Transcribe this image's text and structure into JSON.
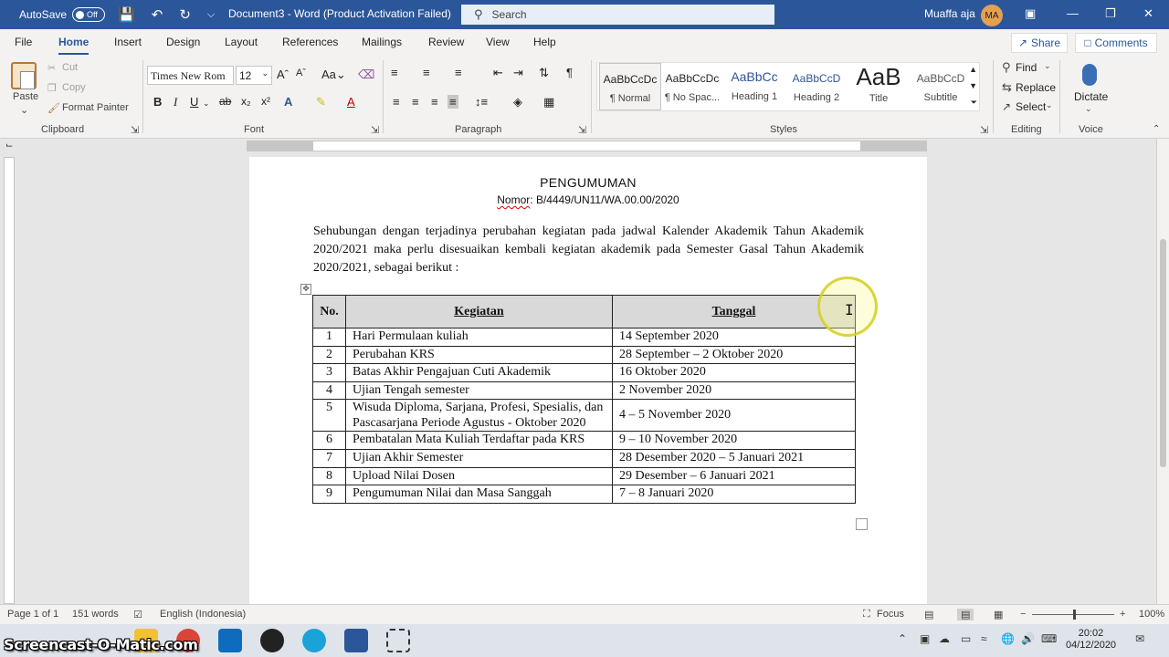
{
  "titlebar": {
    "autosave_label": "AutoSave",
    "autosave_state": "Off",
    "doc_title": "Document3 - Word (Product Activation Failed)",
    "search_placeholder": "Search",
    "user_name": "Muaffa aja",
    "user_initials": "MA"
  },
  "tabs": [
    "File",
    "Home",
    "Insert",
    "Design",
    "Layout",
    "References",
    "Mailings",
    "Review",
    "View",
    "Help"
  ],
  "tabs_active": "Home",
  "share_label": "Share",
  "comments_label": "Comments",
  "ribbon": {
    "clipboard": {
      "paste": "Paste",
      "cut": "Cut",
      "copy": "Copy",
      "format_painter": "Format Painter",
      "label": "Clipboard"
    },
    "font": {
      "name": "Times New Rom",
      "size": "12",
      "label": "Font",
      "grow": "A^",
      "shrink": "Aˇ",
      "case": "Aa"
    },
    "paragraph": {
      "label": "Paragraph"
    },
    "styles": {
      "label": "Styles",
      "items": [
        {
          "preview": "AaBbCcDc",
          "name": "¶ Normal"
        },
        {
          "preview": "AaBbCcDc",
          "name": "¶ No Spac..."
        },
        {
          "preview": "AaBbCc",
          "name": "Heading 1"
        },
        {
          "preview": "AaBbCcD",
          "name": "Heading 2"
        },
        {
          "preview": "AaB",
          "name": "Title"
        },
        {
          "preview": "AaBbCcD",
          "name": "Subtitle"
        }
      ]
    },
    "editing": {
      "find": "Find",
      "replace": "Replace",
      "select": "Select",
      "label": "Editing"
    },
    "voice": {
      "dictate": "Dictate",
      "label": "Voice"
    }
  },
  "document": {
    "heading": "PENGUMUMAN",
    "nomor_label": "Nomor",
    "nomor_value": ": B/4449/UN11/WA.00.00/2020",
    "paragraph": "Sehubungan dengan terjadinya perubahan kegiatan pada jadwal Kalender Akademik Tahun Akademik 2020/2021 maka perlu disesuaikan kembali kegiatan akademik pada Semester Gasal Tahun Akademik 2020/2021, sebagai berikut :",
    "table": {
      "headers": [
        "No.",
        "Kegiatan",
        "Tanggal"
      ],
      "rows": [
        {
          "no": "1",
          "kegiatan": "Hari Permulaan kuliah",
          "tanggal": "14 September 2020"
        },
        {
          "no": "2",
          "kegiatan": "Perubahan KRS",
          "tanggal": "28 September – 2 Oktober 2020"
        },
        {
          "no": "3",
          "kegiatan": "Batas Akhir Pengajuan Cuti Akademik",
          "tanggal": "16 Oktober 2020"
        },
        {
          "no": "4",
          "kegiatan": "Ujian Tengah semester",
          "tanggal": "2 November 2020"
        },
        {
          "no": "5",
          "kegiatan_line1": "Wisuda Diploma, Sarjana, Profesi, Spesialis, dan",
          "kegiatan_line2": "Pascasarjana Periode Agustus - Oktober 2020",
          "tanggal": "4 – 5 November 2020"
        },
        {
          "no": "6",
          "kegiatan": "Pembatalan Mata Kuliah Terdaftar pada KRS",
          "tanggal": "9 – 10 November 2020"
        },
        {
          "no": "7",
          "kegiatan": "Ujian Akhir Semester",
          "tanggal": "28 Desember 2020 – 5 Januari 2021"
        },
        {
          "no": "8",
          "kegiatan": "Upload Nilai Dosen",
          "tanggal": "29 Desember – 6 Januari 2021"
        },
        {
          "no": "9",
          "kegiatan": "Pengumuman Nilai dan Masa Sanggah",
          "tanggal": "7 – 8 Januari 2020"
        }
      ]
    }
  },
  "status": {
    "page": "Page 1 of 1",
    "words": "151 words",
    "language": "English (Indonesia)",
    "focus": "Focus",
    "zoom": "100%"
  },
  "taskbar": {
    "watermark": "Screencast-O-Matic.com",
    "time": "20:02",
    "date": "04/12/2020"
  }
}
